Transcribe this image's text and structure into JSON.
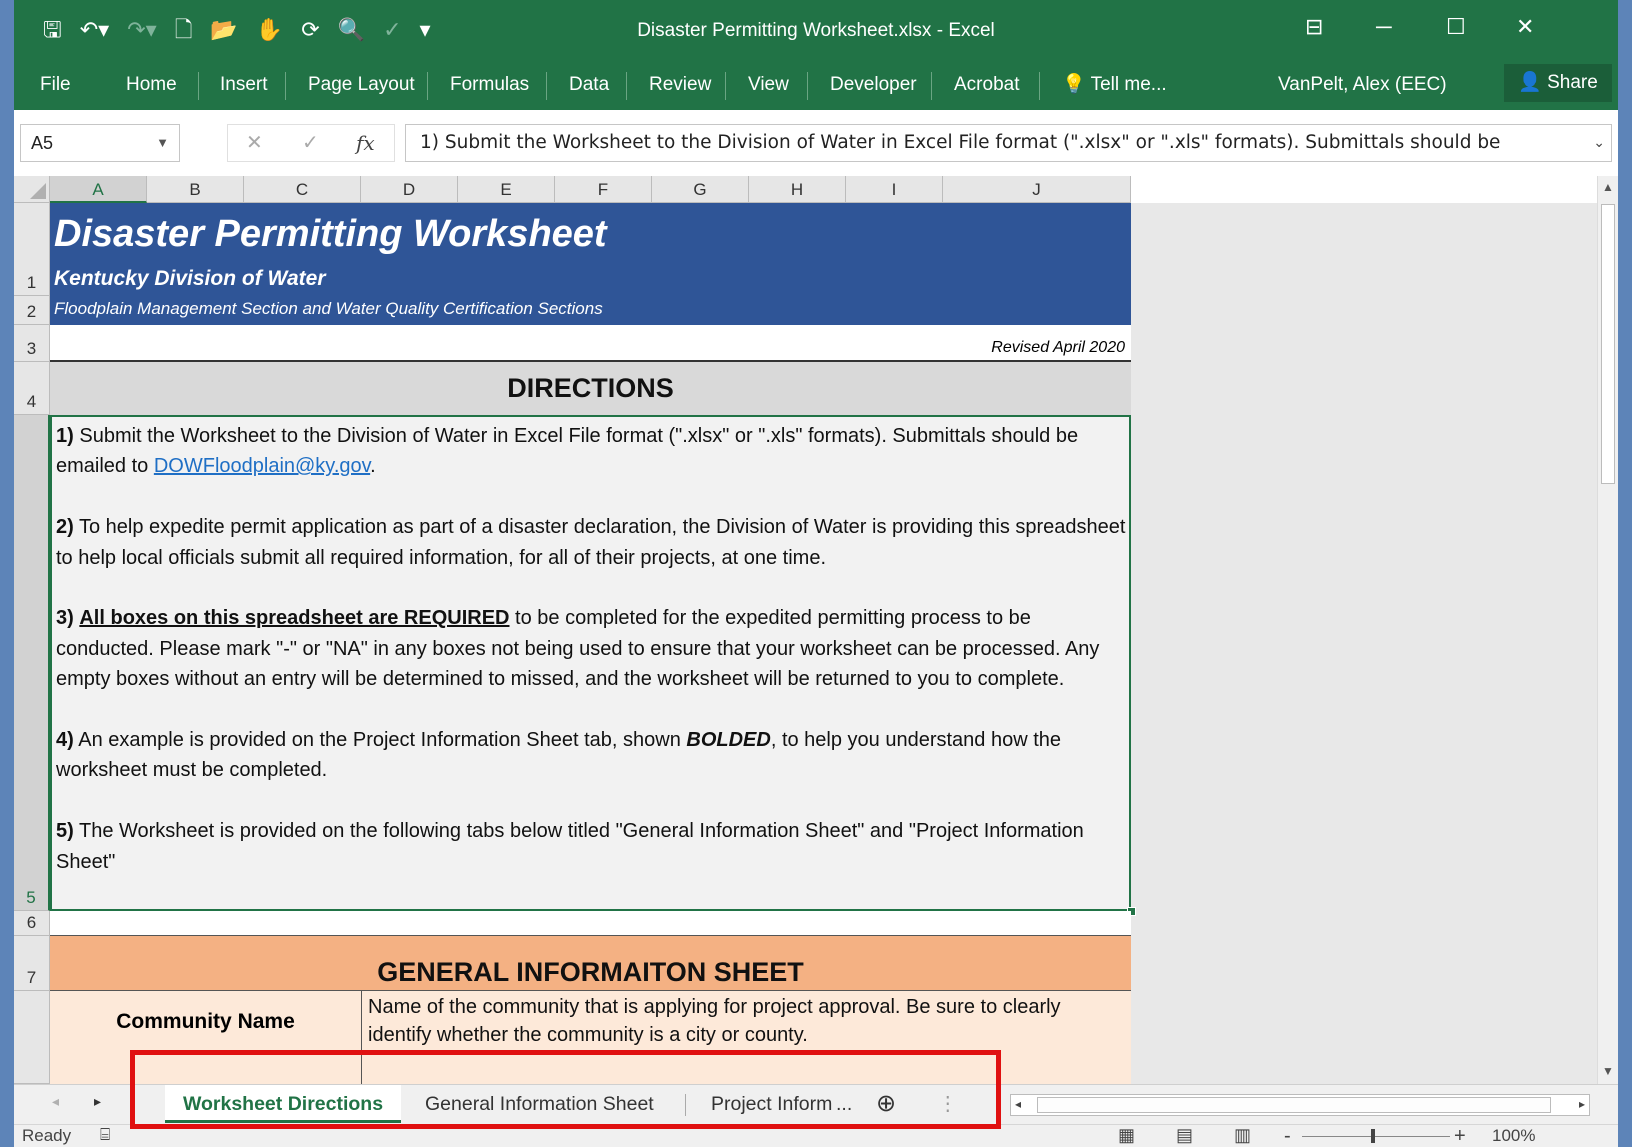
{
  "window": {
    "title": "Disaster Permitting Worksheet.xlsx - Excel",
    "controls": {
      "ribbon_display": "⊟",
      "minimize": "─",
      "maximize": "☐",
      "close": "✕"
    }
  },
  "qat": {
    "save": "🖫",
    "undo": "↶▾",
    "redo": "↷▾",
    "new": "🗋",
    "open": "📂",
    "touch": "✋",
    "sync": "⟳",
    "preview": "🔍",
    "spell": "✓",
    "more": "▾"
  },
  "ribbon": {
    "tabs": [
      "File",
      "Home",
      "Insert",
      "Page Layout",
      "Formulas",
      "Data",
      "Review",
      "View",
      "Developer",
      "Acrobat"
    ],
    "tell_me": "Tell me...",
    "tell_me_icon": "💡",
    "user": "VanPelt, Alex (EEC)",
    "share": "Share",
    "share_icon": "👤"
  },
  "formula_bar": {
    "name_box": "A5",
    "cancel": "✕",
    "enter": "✓",
    "fx": "fx",
    "formula": "1)  Submit the Worksheet to the Division of Water in Excel File format  (\".xlsx\" or \".xls\" formats).  Submittals should be",
    "expand": "⌄"
  },
  "columns": [
    "A",
    "B",
    "C",
    "D",
    "E",
    "F",
    "G",
    "H",
    "I",
    "J"
  ],
  "rows": [
    "1",
    "2",
    "3",
    "4",
    "5",
    "6",
    "7"
  ],
  "sheet": {
    "title": "Disaster Permitting Worksheet",
    "subtitle": "Kentucky Division of Water",
    "sections": "Floodplain Management Section  and  Water Quality Certification Sections",
    "revised": "Revised April 2020",
    "directions_header": "DIRECTIONS",
    "directions": {
      "d1_num": "1)",
      "d1_text": " Submit the Worksheet to the Division of Water in Excel File format  (\".xlsx\" or \".xls\" formats).  Submittals should be emailed to ",
      "d1_email": "DOWFloodplain@ky.gov",
      "d1_end": ".",
      "d2_num": "2)",
      "d2_text": " To help expedite permit application as part of a disaster declaration, the Division of Water is providing this spreadsheet to help local officials submit all required information, for all of their projects, at one time.",
      "d3_num": "3)",
      "d3_bold": "All boxes on this spreadsheet are REQUIRED",
      "d3_text": " to be completed for the expedited permitting process to be conducted.  Please mark \"-\" or \"NA\" in any boxes not being used to ensure that your worksheet can be processed.  Any empty boxes without an entry will be determined to missed, and the worksheet will be returned to you to complete.",
      "d4_num": "4)",
      "d4_text": " An example is provided on the Project Information Sheet tab, shown ",
      "d4_bold": "BOLDED",
      "d4_end": ", to help you understand how the worksheet must be completed.",
      "d5_num": "5)",
      "d5_text": " The Worksheet is provided on the following tabs below titled \"General Information Sheet\" and \"Project Information Sheet\""
    },
    "general_header": "GENERAL INFORMAITON SHEET",
    "community_label": "Community Name",
    "community_desc": "Name of the community that is applying for project approval.  Be sure to clearly identify whether the community is a city or county."
  },
  "sheet_tabs": {
    "tabs": [
      "Worksheet Directions",
      "General Information Sheet",
      "Project Inform"
    ],
    "more": "...",
    "add": "⊕",
    "prev": "◂",
    "next": "▸"
  },
  "status_bar": {
    "ready": "Ready",
    "macro_icon": "⌸",
    "zoom": "100%",
    "zoom_minus": "-",
    "zoom_plus": "+"
  },
  "colors": {
    "excel_green": "#217346",
    "banner_blue": "#2f5597",
    "highlight_red": "#e01010",
    "gen_orange": "#f4b183"
  }
}
